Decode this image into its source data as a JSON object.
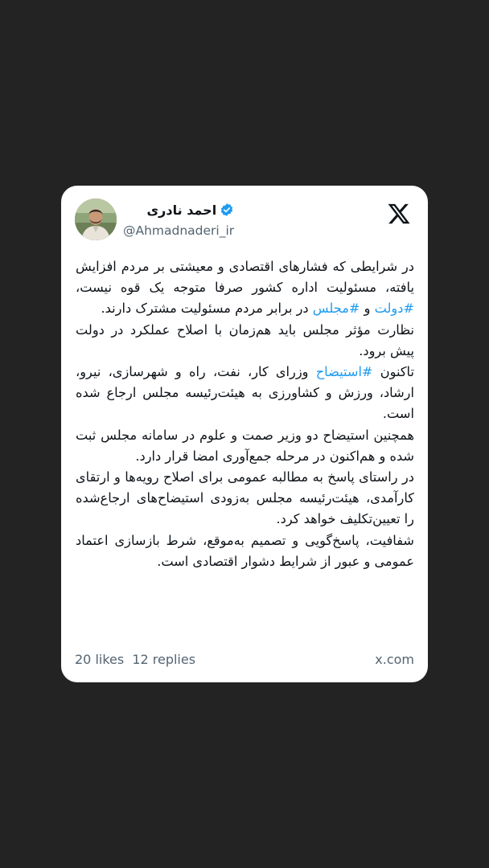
{
  "post": {
    "author": {
      "display_name": "احمد نادری",
      "handle": "@Ahmadnaderi_ir",
      "verified": true,
      "avatar_icon": "profile-photo"
    },
    "platform_icon": "x-logo-icon",
    "paragraphs": [
      [
        {
          "text": "در شرایطی که فشارهای اقتصادی و معیشتی بر مردم افزایش یافته، مسئولیت اداره کشور صرفا متوجه یک قوه نیست، "
        },
        {
          "text": "#دولت",
          "hashtag": true
        },
        {
          "text": " و "
        },
        {
          "text": "#مجلس",
          "hashtag": true
        },
        {
          "text": " در برابر مردم مسئولیت مشترک دارند."
        }
      ],
      [
        {
          "text": "نظارت مؤثر مجلس باید هم‌زمان با اصلاح عملکرد در دولت پیش برود."
        }
      ],
      [
        {
          "text": "تاکنون "
        },
        {
          "text": "#استیضاح",
          "hashtag": true
        },
        {
          "text": " وزرای کار، نفت، راه و شهرسازی، نیرو، ارشاد، ورزش و کشاورزی به هیئت‌رئیسه مجلس ارجاع شده است."
        }
      ],
      [
        {
          "text": "همچنین استیضاح دو وزیر صمت و علوم در سامانه مجلس ثبت شده و هم‌اکنون در مرحله جمع‌آوری امضا قرار دارد."
        }
      ],
      [
        {
          "text": "در راستای پاسخ به مطالبه عمومی برای اصلاح رویه‌ها و ارتقای کارآمدی، هیئت‌رئیسه مجلس به‌زودی استیضاح‌های ارجاع‌شده را تعیین‌تکلیف خواهد کرد."
        }
      ],
      [
        {
          "text": "شفافیت، پاسخ‌گویی و تصمیم به‌موقع، شرط بازسازی اعتماد عمومی و عبور از شرایط دشوار اقتصادی است."
        }
      ]
    ],
    "stats": {
      "likes": "20 likes",
      "replies": "12 replies"
    },
    "domain": "x.com"
  },
  "colors": {
    "background": "#232323",
    "card": "#ffffff",
    "text": "#0f1419",
    "muted": "#536471",
    "hashtag": "#1d9bf0",
    "verified": "#1d9bf0"
  }
}
